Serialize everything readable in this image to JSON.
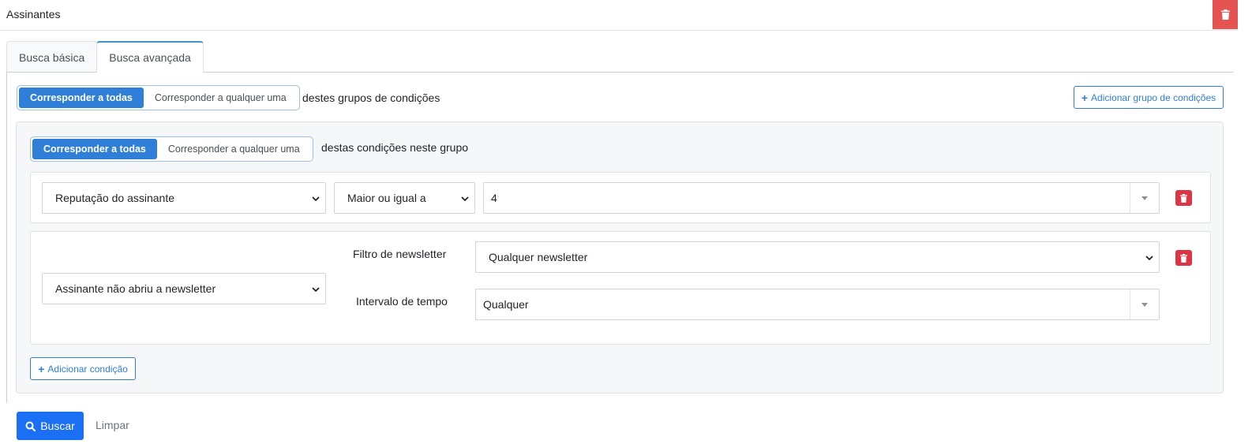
{
  "header": {
    "title": "Assinantes",
    "delete_icon": "trash-icon"
  },
  "tabs": [
    {
      "label": "Busca básica",
      "active": false
    },
    {
      "label": "Busca avançada",
      "active": true
    }
  ],
  "top_match": {
    "options": [
      "Corresponder a todas",
      "Corresponder a qualquer uma"
    ],
    "selected": "Corresponder a todas",
    "suffix": "destes grupos de condições"
  },
  "add_group_label": "Adicionar grupo de condições",
  "group": {
    "match": {
      "options": [
        "Corresponder a todas",
        "Corresponder a qualquer uma"
      ],
      "selected": "Corresponder a todas",
      "suffix": "destas condições neste grupo"
    },
    "conditions": [
      {
        "field": "Reputação do assinante",
        "operator": "Maior ou igual a",
        "value": "4"
      },
      {
        "field": "Assinante não abriu a newsletter",
        "newsletter_filter_label": "Filtro de newsletter",
        "newsletter_filter_value": "Qualquer newsletter",
        "time_range_label": "Intervalo de tempo",
        "time_range_value": "Qualquer"
      }
    ],
    "add_condition_label": "Adicionar condição"
  },
  "actions": {
    "search_label": "Buscar",
    "clear_label": "Limpar"
  },
  "colors": {
    "primary": "#2f7ed8",
    "danger": "#dc3545",
    "search_button": "#1a6ff5"
  }
}
